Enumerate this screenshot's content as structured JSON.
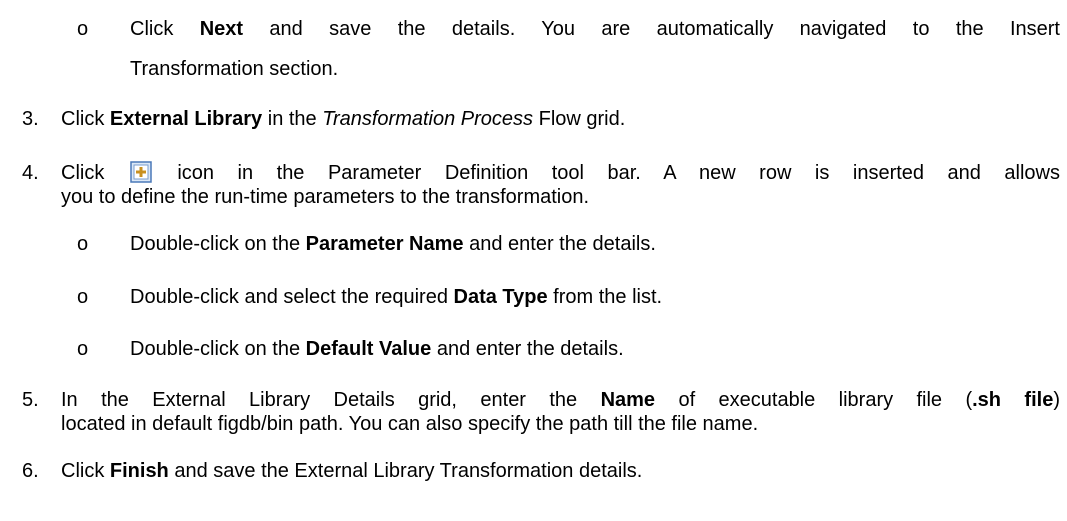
{
  "bullet_glyph": "o",
  "step_intro": {
    "sub1": {
      "pre": "Click ",
      "bold": "Next",
      "post_line1": " and save the details. You are automatically navigated to the Insert",
      "line2": "Transformation section."
    }
  },
  "steps": {
    "s3": {
      "num": "3.",
      "pre": "Click ",
      "bold": "External Library",
      "mid": " in the ",
      "italic": "Transformation Process",
      "post": " Flow grid."
    },
    "s4": {
      "num": "4.",
      "pre": "Click ",
      "icon_name": "insert-row-icon",
      "post_line1": " icon in the Parameter Definition tool bar. A new row is inserted and allows",
      "line2": "you to define the run-time parameters to the transformation.",
      "subs": [
        {
          "pre": "Double-click on the ",
          "bold": "Parameter Name",
          "post": " and enter the details."
        },
        {
          "pre": "Double-click and select the required ",
          "bold": "Data Type",
          "post": " from the list."
        },
        {
          "pre": "Double-click on the ",
          "bold": "Default Value",
          "post": " and enter the details."
        }
      ]
    },
    "s5": {
      "num": "5.",
      "pre": "In the External Library Details grid, enter the ",
      "bold": "Name",
      "mid": " of executable library file (",
      "bold2": ".sh file",
      "post_line1": ")",
      "line2": "located in default figdb/bin path. You can also specify the path till the file name."
    },
    "s6": {
      "num": "6.",
      "pre": "Click ",
      "bold": "Finish",
      "post": " and save the External Library Transformation details."
    }
  },
  "colors": {
    "icon_frame": "#4a78b8",
    "icon_fill": "#dbe8f7",
    "icon_plus": "#c89020"
  }
}
